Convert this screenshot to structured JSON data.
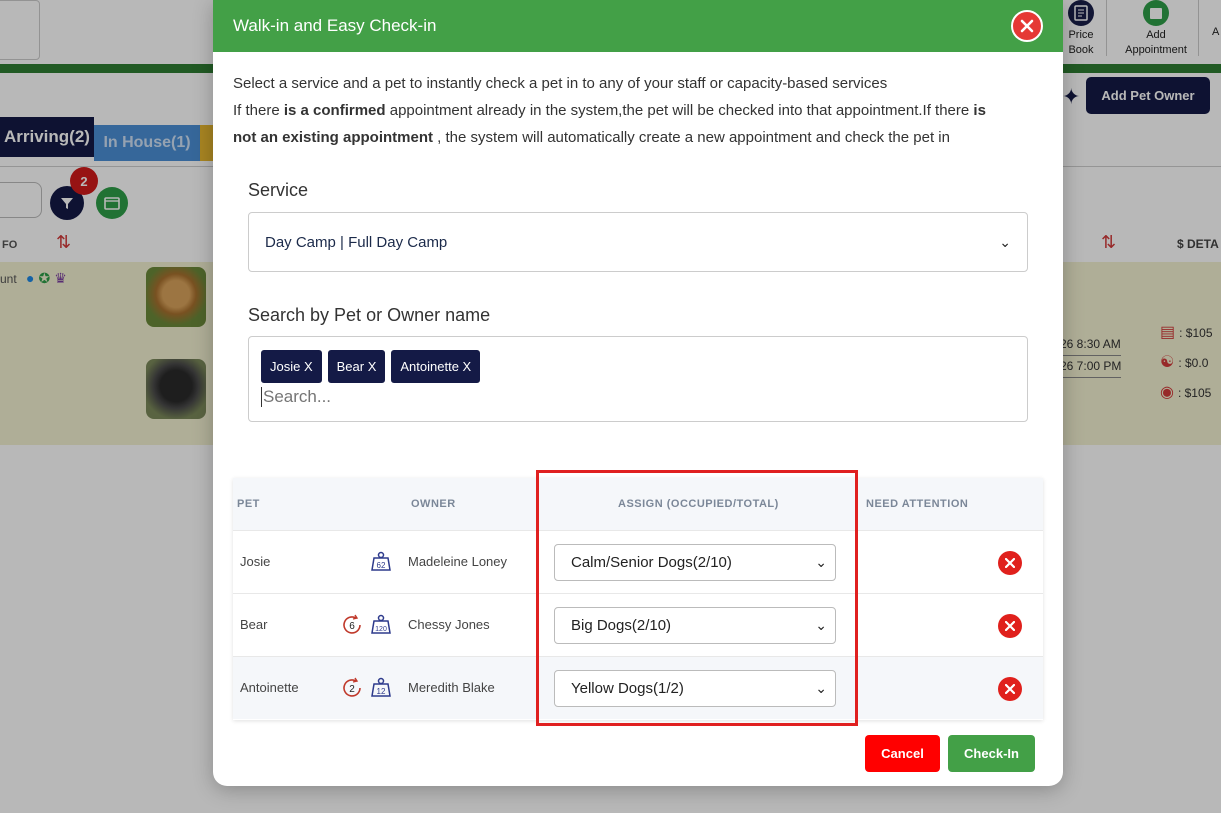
{
  "background": {
    "toolbar": {
      "price_book_label": "Price Book",
      "price_book_line1": "Price",
      "price_book_line2": "Book",
      "add_appointment_line1": "Add",
      "add_appointment_line2": "Appointment",
      "edge_text": "A"
    },
    "add_pet_owner_label": "Add Pet Owner",
    "tabs": {
      "arriving": "Arriving(2)",
      "in_house": "In House(1)"
    },
    "filter_badge_count": "2",
    "columns": {
      "info": "FO",
      "details": "$ DETA"
    },
    "row_text": "unt",
    "times": [
      "26 8:30 AM",
      "26 7:00 PM"
    ],
    "amounts": [
      ": $105",
      ": $0.0",
      ": $105"
    ]
  },
  "modal": {
    "title": "Walk-in and Easy Check-in",
    "intro": {
      "line1": "Select a service and a pet to instantly check a pet in to any of your staff or capacity-based services",
      "line2_a": "If there ",
      "line2_b": "is a confirmed",
      "line2_c": " appointment already in the system,the pet will be checked into that appointment.If there ",
      "line2_d": "is",
      "line3_a": "not an existing appointment",
      "line3_b": " , the system will automatically create a new appointment and check the pet in"
    },
    "service_label": "Service",
    "service_value": "Day Camp | Full Day Camp",
    "search_label": "Search by Pet or Owner name",
    "search_placeholder": "Search...",
    "chips": [
      "Josie X",
      "Bear X",
      "Antoinette X"
    ],
    "table": {
      "headers": {
        "pet": "PET",
        "owner": "OWNER",
        "assign": "ASSIGN (OCCUPIED/TOTAL)",
        "attention": "NEED ATTENTION"
      },
      "rows": [
        {
          "pet": "Josie",
          "owner": "Madeleine Loney",
          "weight": "62",
          "visits": "",
          "assign": "Calm/Senior Dogs(2/10)"
        },
        {
          "pet": "Bear",
          "owner": "Chessy Jones",
          "weight": "120",
          "visits": "6",
          "assign": "Big Dogs(2/10)"
        },
        {
          "pet": "Antoinette",
          "owner": "Meredith Blake",
          "weight": "12",
          "visits": "2",
          "assign": "Yellow Dogs(1/2)"
        }
      ]
    },
    "cancel_label": "Cancel",
    "checkin_label": "Check-In"
  },
  "colors": {
    "header_green": "#43a047",
    "navy": "#141a46",
    "danger_red": "#e0201c",
    "highlight_red": "#e02020"
  }
}
